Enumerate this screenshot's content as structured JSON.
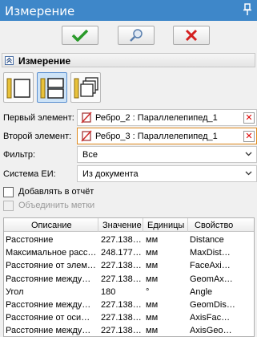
{
  "window": {
    "title": "Измерение"
  },
  "toolbar": {
    "ok": "ok",
    "preview": "preview",
    "cancel": "cancel"
  },
  "section": {
    "title": "Измерение"
  },
  "fields": {
    "first_label": "Первый элемент:",
    "first_value": "Ребро_2 : Параллелепипед_1",
    "second_label": "Второй элемент:",
    "second_value": "Ребро_3 : Параллелепипед_1",
    "filter_label": "Фильтр:",
    "filter_value": "Все",
    "units_label": "Система ЕИ:",
    "units_value": "Из документа"
  },
  "checks": {
    "add_report": "Добавлять в отчёт",
    "merge_labels": "Объединить метки"
  },
  "table": {
    "headers": [
      "Описание",
      "Значение",
      "Единицы",
      "Свойство"
    ],
    "rows": [
      [
        "Расстояние",
        "227.138…",
        "мм",
        "Distance"
      ],
      [
        "Максимальное расс…",
        "248.177…",
        "мм",
        "MaxDist…"
      ],
      [
        "Расстояние от элем…",
        "227.138…",
        "мм",
        "FaceAxi…"
      ],
      [
        "Расстояние между…",
        "227.138…",
        "мм",
        "GeomAx…"
      ],
      [
        "Угол",
        "180",
        "°",
        "Angle"
      ],
      [
        "Расстояние между…",
        "227.138…",
        "мм",
        "GeomDis…"
      ],
      [
        "Расстояние от оси…",
        "227.138…",
        "мм",
        "AxisFac…"
      ],
      [
        "Расстояние между…",
        "227.138…",
        "мм",
        "AxisGeo…"
      ]
    ]
  }
}
